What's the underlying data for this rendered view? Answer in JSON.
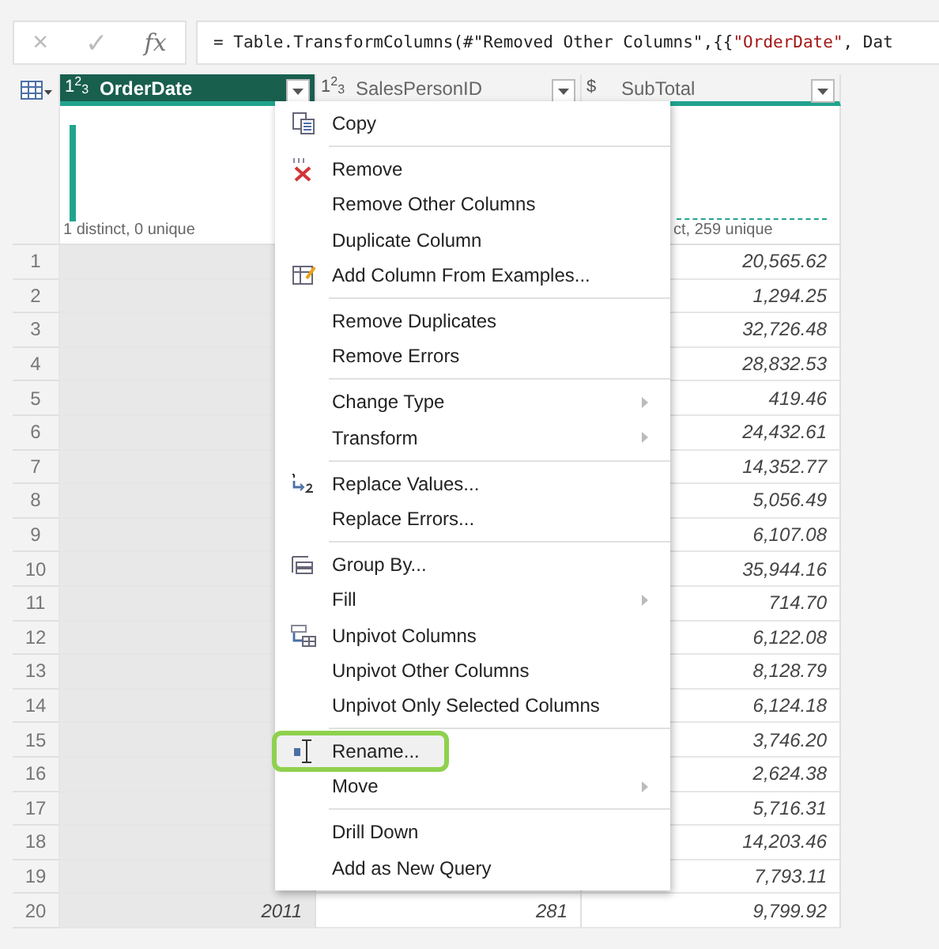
{
  "formula_bar": {
    "cancel": "×",
    "confirm": "✓",
    "fx": "fx",
    "formula": [
      {
        "kind": "plain",
        "text": "= Table.TransformColumns(#\"Removed Other Columns\",{{"
      },
      {
        "kind": "string",
        "text": "\"OrderDate\""
      },
      {
        "kind": "plain",
        "text": ", Dat"
      }
    ]
  },
  "columns": [
    {
      "type_label": "1$^{2}$$_{3}$",
      "name": "OrderDate",
      "selected": true,
      "profile": "1 distinct, 0 unique"
    },
    {
      "type_label": "1$^{2}$$_{3}$",
      "name": "SalesPersonID",
      "selected": false
    },
    {
      "type_label": "$",
      "name": "SubTotal",
      "selected": false,
      "profile": "ct, 259 unique"
    }
  ],
  "rows": [
    {
      "index": "1",
      "subtotal": "20,565.62"
    },
    {
      "index": "2",
      "subtotal": "1,294.25"
    },
    {
      "index": "3",
      "subtotal": "32,726.48"
    },
    {
      "index": "4",
      "subtotal": "28,832.53"
    },
    {
      "index": "5",
      "subtotal": "419.46"
    },
    {
      "index": "6",
      "subtotal": "24,432.61"
    },
    {
      "index": "7",
      "subtotal": "14,352.77"
    },
    {
      "index": "8",
      "subtotal": "5,056.49"
    },
    {
      "index": "9",
      "subtotal": "6,107.08"
    },
    {
      "index": "10",
      "subtotal": "35,944.16"
    },
    {
      "index": "11",
      "subtotal": "714.70"
    },
    {
      "index": "12",
      "subtotal": "6,122.08"
    },
    {
      "index": "13",
      "subtotal": "8,128.79"
    },
    {
      "index": "14",
      "subtotal": "6,124.18"
    },
    {
      "index": "15",
      "subtotal": "3,746.20"
    },
    {
      "index": "16",
      "subtotal": "2,624.38"
    },
    {
      "index": "17",
      "subtotal": "5,716.31"
    },
    {
      "index": "18",
      "subtotal": "14,203.46"
    },
    {
      "index": "19",
      "subtotal": "7,793.11"
    },
    {
      "index": "20",
      "orderdate": "2011",
      "salespersonid": "281",
      "subtotal": "9,799.92"
    }
  ],
  "context_menu": [
    [
      {
        "label": "Copy",
        "kind": "copy",
        "submenu": false,
        "hovered": false
      }
    ],
    [
      {
        "label": "Remove",
        "kind": "remove",
        "submenu": false,
        "hovered": false
      },
      {
        "label": "Remove Other Columns",
        "kind": "plain",
        "submenu": false,
        "hovered": false
      },
      {
        "label": "Duplicate Column",
        "kind": "plain",
        "submenu": false,
        "hovered": false
      },
      {
        "label": "Add Column From Examples...",
        "kind": "examples",
        "submenu": false,
        "hovered": false
      }
    ],
    [
      {
        "label": "Remove Duplicates",
        "kind": "plain",
        "submenu": false,
        "hovered": false
      },
      {
        "label": "Remove Errors",
        "kind": "plain",
        "submenu": false,
        "hovered": false
      }
    ],
    [
      {
        "label": "Change Type",
        "kind": "plain",
        "submenu": true,
        "hovered": false
      },
      {
        "label": "Transform",
        "kind": "plain",
        "submenu": true,
        "hovered": false
      }
    ],
    [
      {
        "label": "Replace Values...",
        "kind": "replace",
        "submenu": false,
        "hovered": false
      },
      {
        "label": "Replace Errors...",
        "kind": "plain",
        "submenu": false,
        "hovered": false
      }
    ],
    [
      {
        "label": "Group By...",
        "kind": "group",
        "submenu": false,
        "hovered": false
      },
      {
        "label": "Fill",
        "kind": "plain",
        "submenu": true,
        "hovered": false
      },
      {
        "label": "Unpivot Columns",
        "kind": "unpivot",
        "submenu": false,
        "hovered": false
      },
      {
        "label": "Unpivot Other Columns",
        "kind": "plain",
        "submenu": false,
        "hovered": false
      },
      {
        "label": "Unpivot Only Selected Columns",
        "kind": "plain",
        "submenu": false,
        "hovered": false
      }
    ],
    [
      {
        "label": "Rename...",
        "kind": "rename",
        "submenu": false,
        "hovered": true
      },
      {
        "label": "Move",
        "kind": "plain",
        "submenu": true,
        "hovered": false
      }
    ],
    [
      {
        "label": "Drill Down",
        "kind": "plain",
        "submenu": false,
        "hovered": false
      },
      {
        "label": "Add as New Query",
        "kind": "plain",
        "submenu": false,
        "hovered": false
      }
    ]
  ]
}
